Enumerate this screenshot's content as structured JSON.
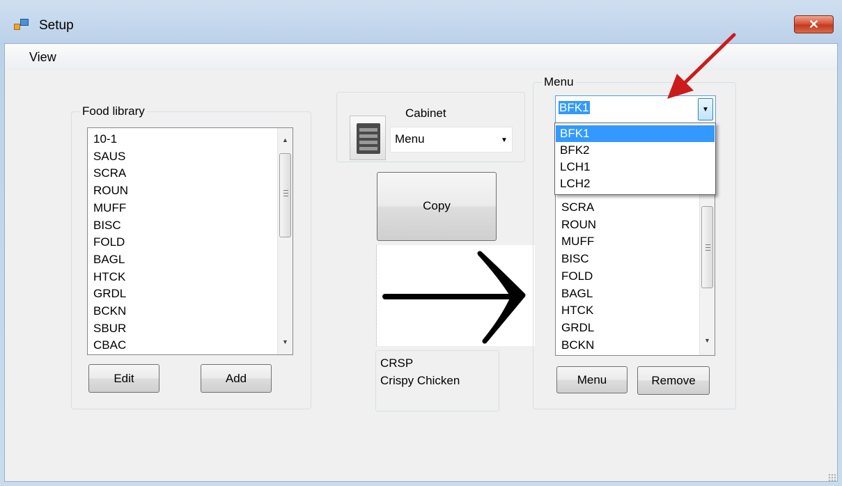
{
  "window": {
    "title": "Setup",
    "close_label": "✕"
  },
  "menubar": {
    "items": [
      "View"
    ]
  },
  "food_library": {
    "label": "Food library",
    "items": [
      "10-1",
      "SAUS",
      "SCRA",
      "ROUN",
      "MUFF",
      "BISC",
      "FOLD",
      "BAGL",
      "HTCK",
      "GRDL",
      "BCKN",
      "SBUR",
      "CBAC"
    ],
    "edit_label": "Edit",
    "add_label": "Add"
  },
  "cabinet": {
    "label": "Cabinet",
    "selected": "Menu"
  },
  "copy_label": "Copy",
  "selected_food": {
    "code": "CRSP",
    "name": "Crispy Chicken"
  },
  "menu_group": {
    "label": "Menu",
    "selected": "BFK1",
    "dropdown_options": [
      "BFK1",
      "BFK2",
      "LCH1",
      "LCH2"
    ],
    "items": [
      "SCRA",
      "ROUN",
      "MUFF",
      "BISC",
      "FOLD",
      "BAGL",
      "HTCK",
      "GRDL",
      "BCKN"
    ],
    "menu_button_label": "Menu",
    "remove_label": "Remove"
  },
  "colors": {
    "selection": "#3399ff",
    "annotation_arrow": "#cc1b1b",
    "close_button": "#c23a22"
  }
}
